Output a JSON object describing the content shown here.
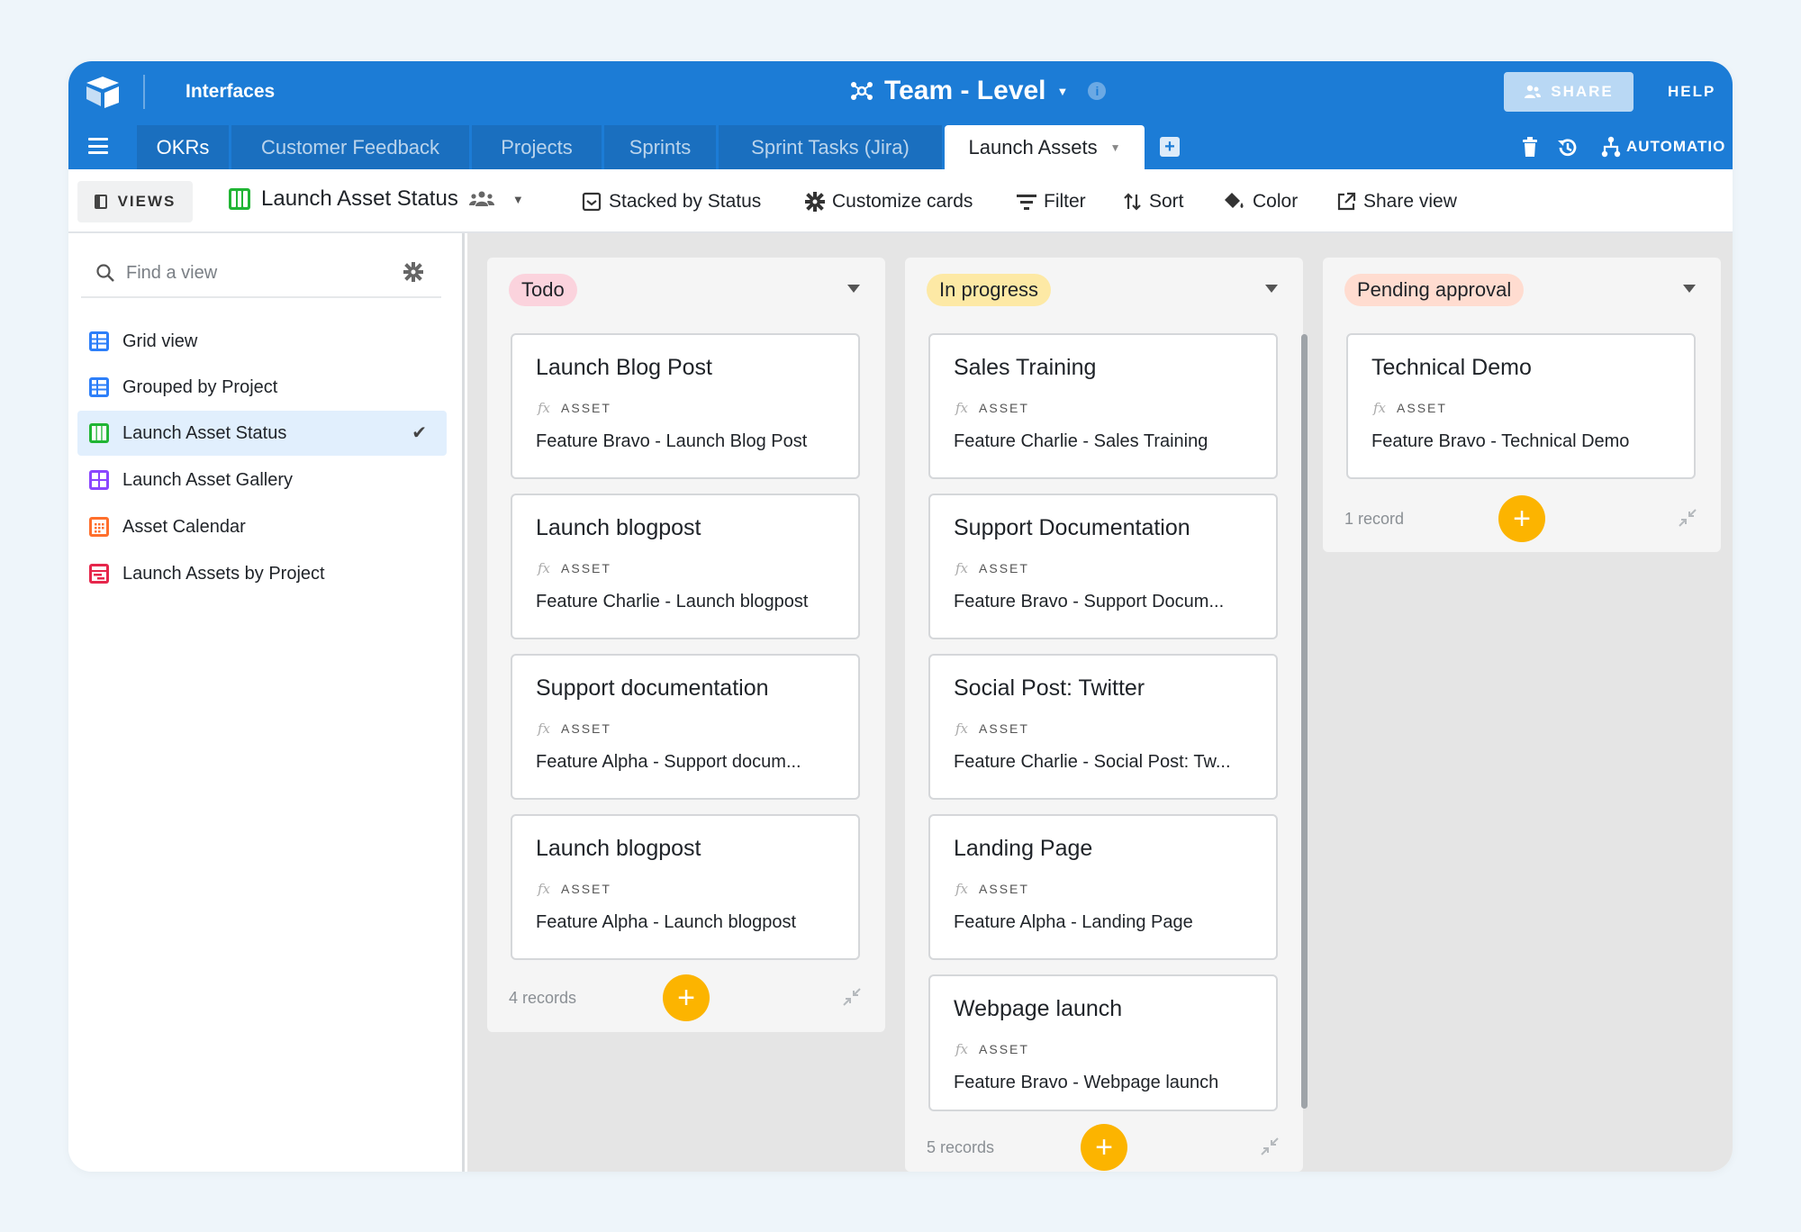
{
  "header": {
    "interfaces_label": "Interfaces",
    "base_title": "Team - Level",
    "share_label": "SHARE",
    "help_label": "HELP"
  },
  "tabs": [
    {
      "label": "OKRs"
    },
    {
      "label": "Customer Feedback"
    },
    {
      "label": "Projects"
    },
    {
      "label": "Sprints"
    },
    {
      "label": "Sprint Tasks (Jira)"
    },
    {
      "label": "Launch Assets"
    }
  ],
  "tabs_right": {
    "automations_label": "AUTOMATIO"
  },
  "viewbar": {
    "views_label": "VIEWS",
    "current_view": "Launch Asset Status",
    "stacked": "Stacked by Status",
    "customize": "Customize cards",
    "filter": "Filter",
    "sort": "Sort",
    "color": "Color",
    "share_view": "Share view"
  },
  "sidebar": {
    "search_placeholder": "Find a view",
    "items": [
      {
        "label": "Grid view",
        "icon": "grid-icon",
        "color": "#2d7ff9"
      },
      {
        "label": "Grouped by Project",
        "icon": "grid-icon",
        "color": "#2d7ff9"
      },
      {
        "label": "Launch Asset Status",
        "icon": "kanban-icon",
        "color": "#20b534"
      },
      {
        "label": "Launch Asset Gallery",
        "icon": "gallery-icon",
        "color": "#8b46ff"
      },
      {
        "label": "Asset Calendar",
        "icon": "calendar-icon",
        "color": "#ff6f2c"
      },
      {
        "label": "Launch Assets by Project",
        "icon": "gantt-icon",
        "color": "#e6264b"
      }
    ]
  },
  "board": {
    "field_label": "ASSET",
    "columns": [
      {
        "name": "Todo",
        "color": "#fbd3dd",
        "count": "4 records",
        "cards": [
          {
            "title": "Launch Blog Post",
            "value": "Feature Bravo - Launch Blog Post"
          },
          {
            "title": "Launch blogpost",
            "value": "Feature Charlie - Launch blogpost"
          },
          {
            "title": "Support documentation",
            "value": "Feature Alpha - Support docum..."
          },
          {
            "title": "Launch blogpost",
            "value": "Feature Alpha - Launch blogpost"
          }
        ]
      },
      {
        "name": "In progress",
        "color": "#fde9a5",
        "count": "5 records",
        "cards": [
          {
            "title": "Sales Training",
            "value": "Feature Charlie - Sales Training"
          },
          {
            "title": "Support Documentation",
            "value": "Feature Bravo - Support Docum..."
          },
          {
            "title": "Social Post: Twitter",
            "value": "Feature Charlie - Social Post: Tw..."
          },
          {
            "title": "Landing Page",
            "value": "Feature Alpha - Landing Page"
          },
          {
            "title": "Webpage launch",
            "value": "Feature Bravo - Webpage launch"
          }
        ]
      },
      {
        "name": "Pending approval",
        "color": "#ffdcd0",
        "count": "1 record",
        "cards": [
          {
            "title": "Technical Demo",
            "value": "Feature Bravo - Technical Demo"
          }
        ]
      }
    ]
  },
  "colors": {
    "header_blue": "#1c7cd6",
    "add_button": "#fcb400"
  }
}
